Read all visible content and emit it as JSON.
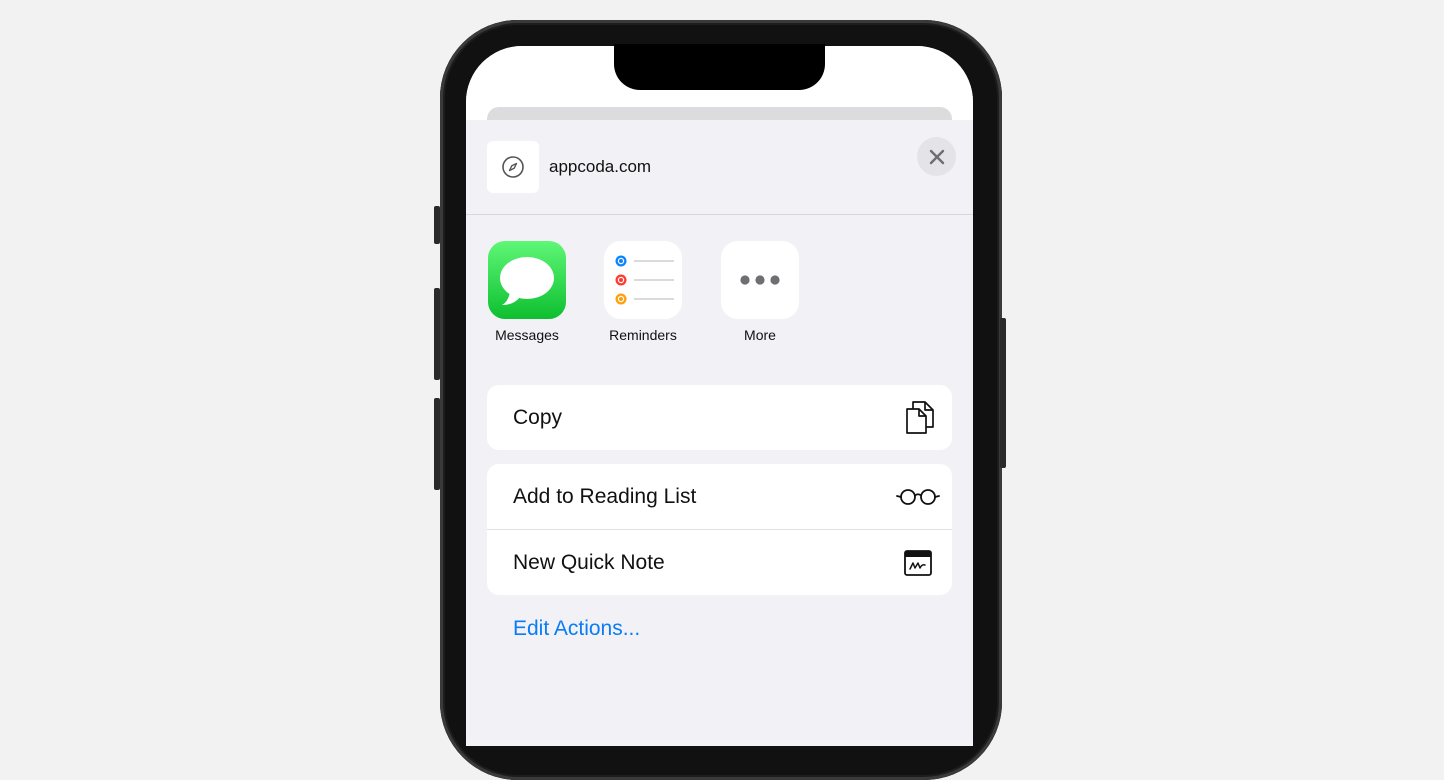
{
  "share_sheet": {
    "header": {
      "site_title": "appcoda.com",
      "thumbnail_icon": "compass-icon",
      "close_icon": "close-icon"
    },
    "apps": [
      {
        "label": "Messages",
        "icon": "messages-icon"
      },
      {
        "label": "Reminders",
        "icon": "reminders-icon"
      },
      {
        "label": "More",
        "icon": "more-icon"
      }
    ],
    "actions": [
      {
        "label": "Copy",
        "icon": "copy-icon"
      },
      {
        "label": "Add to Reading List",
        "icon": "glasses-icon"
      },
      {
        "label": "New Quick Note",
        "icon": "quick-note-icon"
      }
    ],
    "edit_actions_label": "Edit Actions..."
  },
  "colors": {
    "link_blue": "#0a7cf5",
    "messages_green": "#34c759",
    "sheet_background": "#f2f2f6",
    "reminder_blue": "#0a84ff",
    "reminder_red": "#ff3b30",
    "reminder_orange": "#ff9f0a"
  }
}
